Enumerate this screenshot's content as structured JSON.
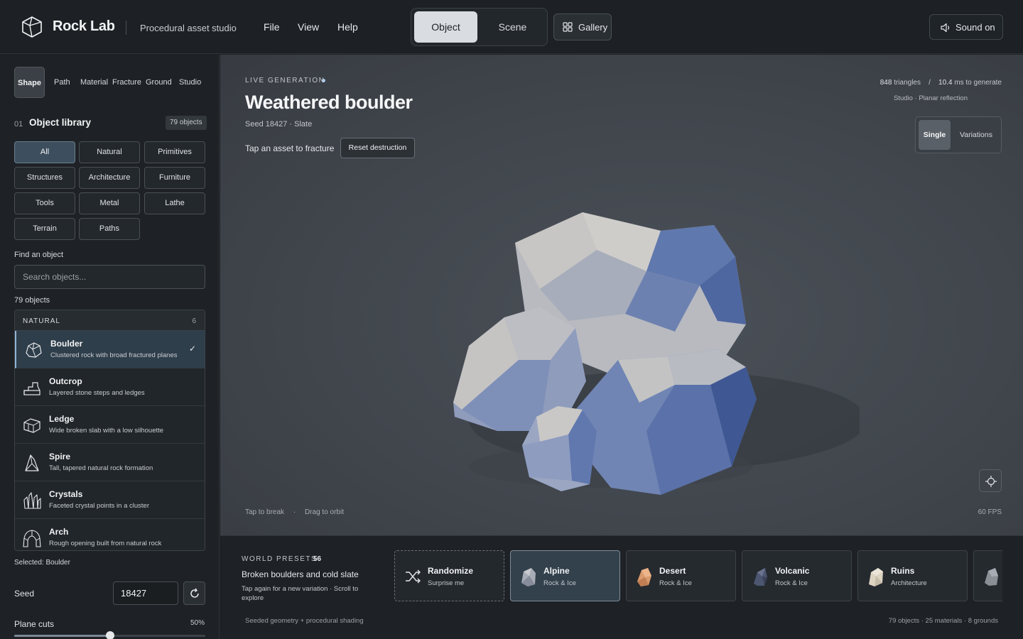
{
  "header": {
    "brand": "Rock Lab",
    "tagline": "Procedural asset studio",
    "menu": [
      "File",
      "View",
      "Help"
    ],
    "modes": [
      "Object",
      "Scene"
    ],
    "active_mode": "Object",
    "gallery_label": "Gallery",
    "sound_label": "Sound on"
  },
  "sidebar": {
    "tabs": [
      "Shape",
      "Path",
      "Material",
      "Fracture",
      "Ground",
      "Studio"
    ],
    "active_tab": "Shape",
    "section_number": "01",
    "section_title": "Object library",
    "object_count_badge": "79 objects",
    "categories": [
      "All",
      "Natural",
      "Primitives",
      "Structures",
      "Architecture",
      "Furniture",
      "Tools",
      "Metal",
      "Lathe",
      "Terrain",
      "Paths"
    ],
    "active_category": "All",
    "find_label": "Find an object",
    "search_placeholder": "Search objects...",
    "results_count": "79 objects",
    "list_header": "NATURAL",
    "list_header_count": "6",
    "items": [
      {
        "name": "Boulder",
        "desc": "Clustered rock with broad fractured planes",
        "icon": "boulder-icon",
        "selected": true
      },
      {
        "name": "Outcrop",
        "desc": "Layered stone steps and ledges",
        "icon": "outcrop-icon"
      },
      {
        "name": "Ledge",
        "desc": "Wide broken slab with a low silhouette",
        "icon": "ledge-icon"
      },
      {
        "name": "Spire",
        "desc": "Tall, tapered natural rock formation",
        "icon": "spire-icon"
      },
      {
        "name": "Crystals",
        "desc": "Faceted crystal points in a cluster",
        "icon": "crystals-icon"
      },
      {
        "name": "Arch",
        "desc": "Rough opening built from natural rock",
        "icon": "arch-icon"
      }
    ],
    "selected_label": "Selected: Boulder",
    "seed_label": "Seed",
    "seed_value": "18427",
    "cuts_label": "Plane cuts",
    "cuts_value": "50%",
    "cuts_fraction": 0.5
  },
  "viewport": {
    "live_label": "LIVE GENERATION",
    "title": "Weathered boulder",
    "subtitle": "Seed 18427 · Slate",
    "tap_hint": "Tap an asset to fracture",
    "reset_label": "Reset destruction",
    "triangles": "848",
    "triangles_unit": "triangles",
    "stats_sep": "/",
    "gen_time": "10.4",
    "gen_unit": "ms to generate",
    "studio_note": "Studio · Planar reflection",
    "view_modes": [
      "Single",
      "Variations"
    ],
    "active_view": "Single",
    "hint_break": "Tap to break",
    "hint_sep": "·",
    "hint_orbit": "Drag to orbit",
    "fps": "60 FPS",
    "colors": {
      "rock_light": "#c9c8c6",
      "rock_blue": "#5a72a8",
      "rock_mid": "#8d9cb8"
    }
  },
  "presets": {
    "label": "WORLD PRESETS",
    "count": "56",
    "title": "Broken boulders and cold slate",
    "desc": "Tap again for a new variation · Scroll to explore",
    "cards": [
      {
        "name": "Randomize",
        "sub": "Surprise me",
        "icon": "shuffle-icon"
      },
      {
        "name": "Alpine",
        "sub": "Rock & Ice",
        "icon": "alpine-rock-icon",
        "color": "#a7acb6"
      },
      {
        "name": "Desert",
        "sub": "Rock & Ice",
        "icon": "desert-rock-icon",
        "color": "#d99a6c"
      },
      {
        "name": "Volcanic",
        "sub": "Rock & Ice",
        "icon": "volcanic-rock-icon",
        "color": "#4d5670"
      },
      {
        "name": "Ruins",
        "sub": "Architecture",
        "icon": "ruins-rock-icon",
        "color": "#ddd3c2"
      }
    ],
    "active_card": "Alpine",
    "footer_note": "Seeded geometry + procedural shading",
    "footer_stats": "79 objects · 25 materials · 8 grounds"
  }
}
